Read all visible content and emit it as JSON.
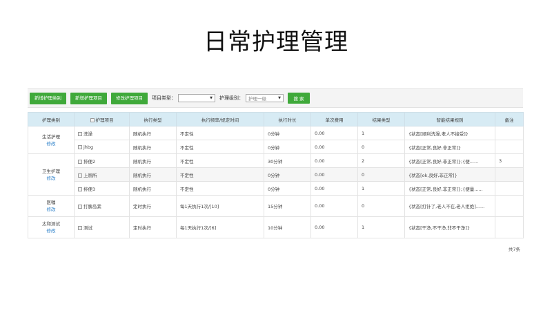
{
  "page": {
    "title": "日常护理管理"
  },
  "toolbar": {
    "buttons": [
      "新增护理类别",
      "新增护理项目",
      "修改护理项目"
    ],
    "item_type_label": "项目类型：",
    "item_type_value": "",
    "level_label": "护理级别：",
    "level_value": "护理一级",
    "search_label": "搜 索"
  },
  "table": {
    "headers": [
      "护理类别",
      "护理项目",
      "执行类型",
      "执行频率/规定时间",
      "执行时长",
      "单次费用",
      "结果类型",
      "智能结果规则",
      "备注"
    ],
    "edit_label": "修改",
    "categories": [
      "生活护理",
      "卫生护理",
      "医嘱",
      "太和测试"
    ],
    "rows": [
      {
        "item": "洗澡",
        "exec": "随机执行",
        "freq": "不定性",
        "duration": "0分钟",
        "fee": "0.00",
        "result_type": "1",
        "rule": "{状态[顺利洗澡,老人不接受]}",
        "note": ""
      },
      {
        "item": "jhbg",
        "exec": "随机执行",
        "freq": "不定性",
        "duration": "0分钟",
        "fee": "0.00",
        "result_type": "0",
        "rule": "{状态[正常,良好,非正常]}",
        "note": ""
      },
      {
        "item": "排便2",
        "exec": "随机执行",
        "freq": "不定性",
        "duration": "30分钟",
        "fee": "0.00",
        "result_type": "2",
        "rule": "{状态[正常,良好,非正常]};{便......",
        "note": "3"
      },
      {
        "item": "上厕所",
        "exec": "随机执行",
        "freq": "不定性",
        "duration": "0分钟",
        "fee": "0.00",
        "result_type": "0",
        "rule": "{状态[ok,良好,非正常]}",
        "note": ""
      },
      {
        "item": "排便3",
        "exec": "随机执行",
        "freq": "不定性",
        "duration": "0分钟",
        "fee": "0.00",
        "result_type": "1",
        "rule": "{状态[正常,良好,非正常]};{便量......",
        "note": ""
      },
      {
        "item": "打胰岛素",
        "exec": "定时执行",
        "freq": "每1天执行1次/[10]",
        "duration": "15分钟",
        "fee": "0.00",
        "result_type": "0",
        "rule": "{状态[打针了,老人不在,老人拒绝]......",
        "note": ""
      },
      {
        "item": "测试",
        "exec": "定时执行",
        "freq": "每1天执行1次/[6]",
        "duration": "10分钟",
        "fee": "0.00",
        "result_type": "1",
        "rule": "{状态[干净,不干净,非不干净]}",
        "note": ""
      }
    ]
  },
  "footer": {
    "total": "共7条"
  }
}
